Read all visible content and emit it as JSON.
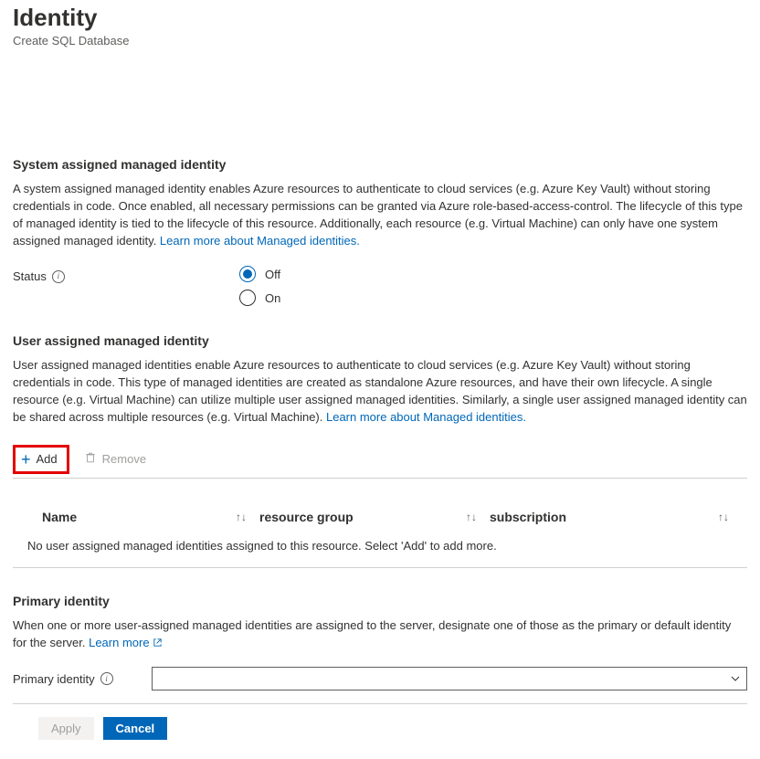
{
  "header": {
    "title": "Identity",
    "subtitle": "Create SQL Database"
  },
  "system_identity": {
    "heading": "System assigned managed identity",
    "description": "A system assigned managed identity enables Azure resources to authenticate to cloud services (e.g. Azure Key Vault) without storing credentials in code. Once enabled, all necessary permissions can be granted via Azure role-based-access-control. The lifecycle of this type of managed identity is tied to the lifecycle of this resource. Additionally, each resource (e.g. Virtual Machine) can only have one system assigned managed identity. ",
    "learn_more": "Learn more about Managed identities.",
    "status_label": "Status",
    "options": {
      "off": "Off",
      "on": "On"
    },
    "selected": "off"
  },
  "user_identity": {
    "heading": "User assigned managed identity",
    "description": "User assigned managed identities enable Azure resources to authenticate to cloud services (e.g. Azure Key Vault) without storing credentials in code. This type of managed identities are created as standalone Azure resources, and have their own lifecycle. A single resource (e.g. Virtual Machine) can utilize multiple user assigned managed identities. Similarly, a single user assigned managed identity can be shared across multiple resources (e.g. Virtual Machine). ",
    "learn_more": "Learn more about Managed identities.",
    "toolbar": {
      "add": "Add",
      "remove": "Remove"
    },
    "columns": {
      "name": "Name",
      "resource_group": "resource group",
      "subscription": "subscription"
    },
    "empty_message": "No user assigned managed identities assigned to this resource. Select 'Add' to add more."
  },
  "primary": {
    "heading": "Primary identity",
    "description": "When one or more user-assigned managed identities are assigned to the server, designate one of those as the primary or default identity for the server. ",
    "learn_more": "Learn more",
    "label": "Primary identity",
    "selected_value": ""
  },
  "footer": {
    "apply": "Apply",
    "cancel": "Cancel"
  }
}
